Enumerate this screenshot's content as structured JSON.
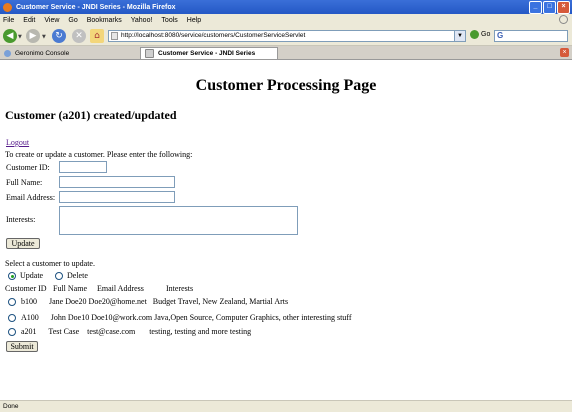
{
  "window": {
    "title": "Customer Service - JNDI Series - Mozilla Firefox",
    "controls": [
      "_",
      "□",
      "×"
    ]
  },
  "menu": [
    "File",
    "Edit",
    "View",
    "Go",
    "Bookmarks",
    "Yahoo!",
    "Tools",
    "Help"
  ],
  "toolbar": {
    "url": "http://localhost:8080/service/customers/CustomerServiceServlet",
    "go_label": "Go",
    "search_value": "G"
  },
  "tabs": [
    {
      "label": "Geronimo Console"
    },
    {
      "label": "Customer Service - JNDI Series"
    }
  ],
  "page": {
    "title": "Customer Processing Page",
    "subtitle": "Customer (a201) created/updated",
    "logout": "Logout",
    "instructions": "To create or update a customer. Please enter the following:",
    "form": {
      "customer_id_label": "Customer ID:",
      "full_name_label": "Full Name:",
      "email_label": "Email Address:",
      "interests_label": "Interests:",
      "customer_id_value": "",
      "full_name_value": "",
      "email_value": "",
      "interests_value": ""
    },
    "update_button": "Update",
    "select_prompt": "Select a customer to update.",
    "action_update": "Update",
    "action_delete": "Delete",
    "selected_action": "Update",
    "table": {
      "headers": [
        "Customer ID",
        "Full Name",
        "Email Address",
        "Interests"
      ],
      "rows": [
        {
          "line": "b100      Jane Doe20 Doe20@home.net   Budget Travel, New Zealand, Martial Arts"
        },
        {
          "line": "A100      John Doe10 Doe10@work.com Java,Open Source, Computer Graphics, other interesting stuff"
        },
        {
          "line": "a201      Test Case    test@case.com       testing, testing and more testing"
        }
      ]
    },
    "submit_button": "Submit"
  },
  "status": "Done"
}
